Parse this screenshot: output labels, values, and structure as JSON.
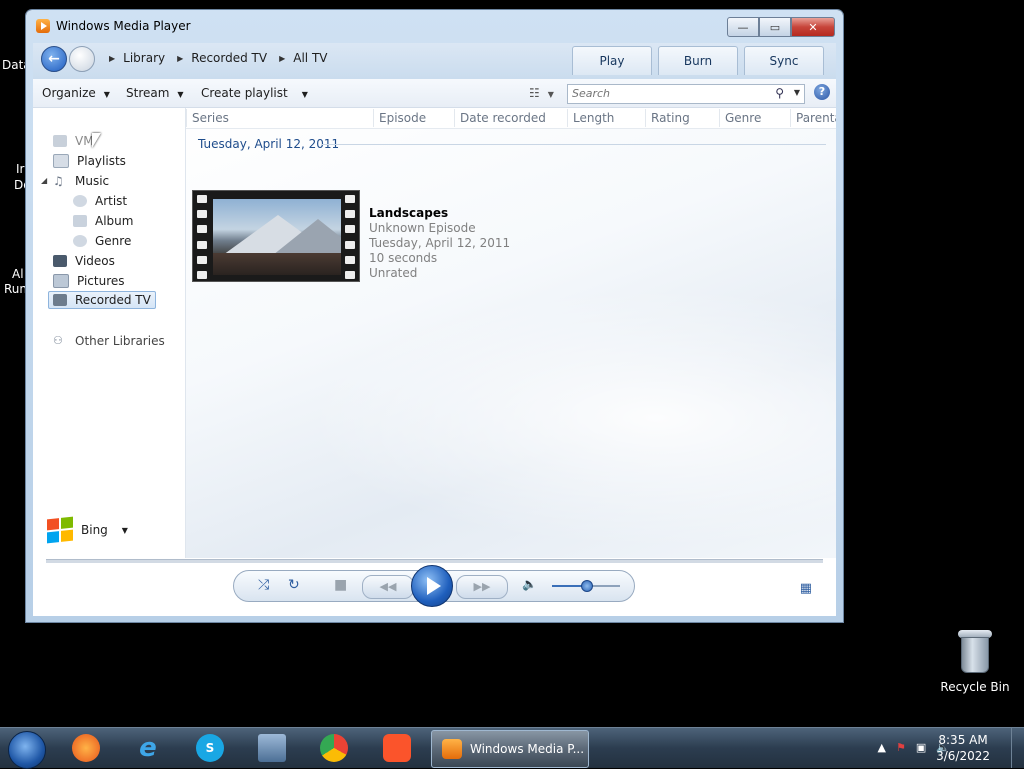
{
  "desktop": {
    "left_icon_fragments": [
      "Data",
      "Ir",
      "Do",
      "Al",
      "Run"
    ],
    "recycle_bin_label": "Recycle Bin"
  },
  "window": {
    "title": "Windows Media Player",
    "controls": {
      "minimize": "—",
      "maximize": "▭",
      "close": "✕"
    }
  },
  "navbar": {
    "breadcrumb": [
      "Library",
      "Recorded TV",
      "All TV"
    ],
    "tabs": [
      "Play",
      "Burn",
      "Sync"
    ]
  },
  "toolbar": {
    "organize": "Organize",
    "stream": "Stream",
    "create_playlist": "Create playlist",
    "search_placeholder": "Search"
  },
  "sidebar": {
    "items": [
      {
        "label": "VM"
      },
      {
        "label": "Playlists"
      },
      {
        "label": "Music"
      },
      {
        "label": "Artist"
      },
      {
        "label": "Album"
      },
      {
        "label": "Genre"
      },
      {
        "label": "Videos"
      },
      {
        "label": "Pictures"
      },
      {
        "label": "Recorded TV",
        "selected": true
      },
      {
        "label": "Other Libraries"
      }
    ],
    "bing_label": "Bing"
  },
  "columns": [
    "Series",
    "Episode",
    "Date recorded",
    "Length",
    "Rating",
    "Genre",
    "Parenta"
  ],
  "group_header": "Tuesday, April 12, 2011",
  "item": {
    "title": "Landscapes",
    "episode": "Unknown Episode",
    "date": "Tuesday, April 12, 2011",
    "length": "10 seconds",
    "rating": "Unrated"
  },
  "player": {
    "volume_level": 0.5
  },
  "taskbar": {
    "active_window_label": "Windows Media P...",
    "clock_time": "8:35 AM",
    "clock_date": "3/6/2022"
  }
}
